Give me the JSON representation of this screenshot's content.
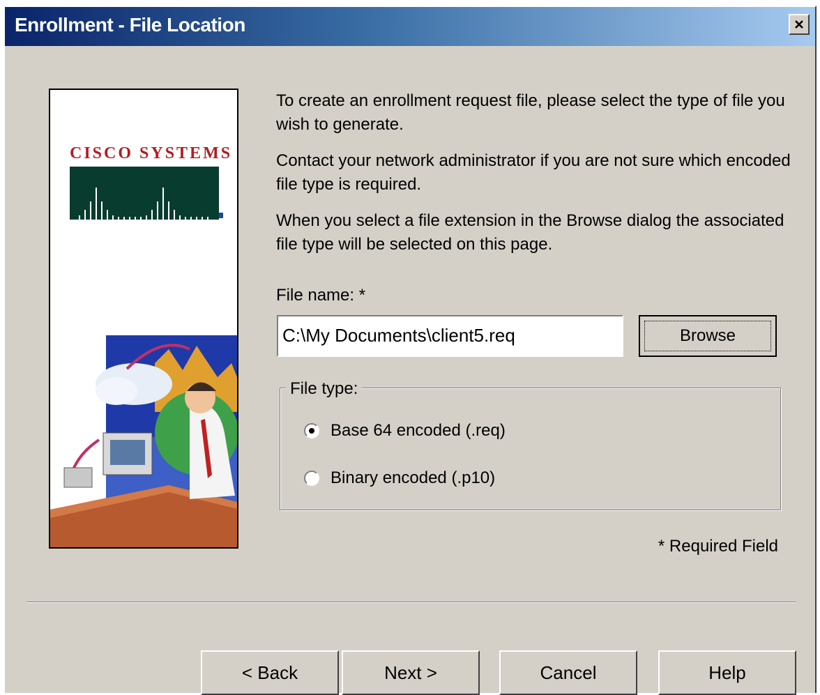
{
  "window": {
    "title": "Enrollment - File Location",
    "close_icon": "close-icon"
  },
  "side_panel": {
    "logo_text": "Cisco Systems",
    "brand_color": "#b21d24"
  },
  "content": {
    "paragraph1": "To create an enrollment request file, please select the type of file you wish to generate.",
    "paragraph2": "Contact your network administrator if you are not sure which encoded file type is required.",
    "paragraph3": "When you select a file extension in the Browse dialog the associated file type will be selected on this page.",
    "file_name_label": "File name: *",
    "file_name_value": "C:\\My Documents\\client5.req",
    "browse_label": "Browse",
    "file_type_label": "File type:",
    "options": [
      {
        "label": "Base 64 encoded (.req)",
        "checked": true
      },
      {
        "label": "Binary encoded (.p10)",
        "checked": false
      }
    ],
    "required_note": "* Required Field"
  },
  "buttons": {
    "back": "< Back",
    "next": "Next >",
    "cancel": "Cancel",
    "help": "Help"
  }
}
